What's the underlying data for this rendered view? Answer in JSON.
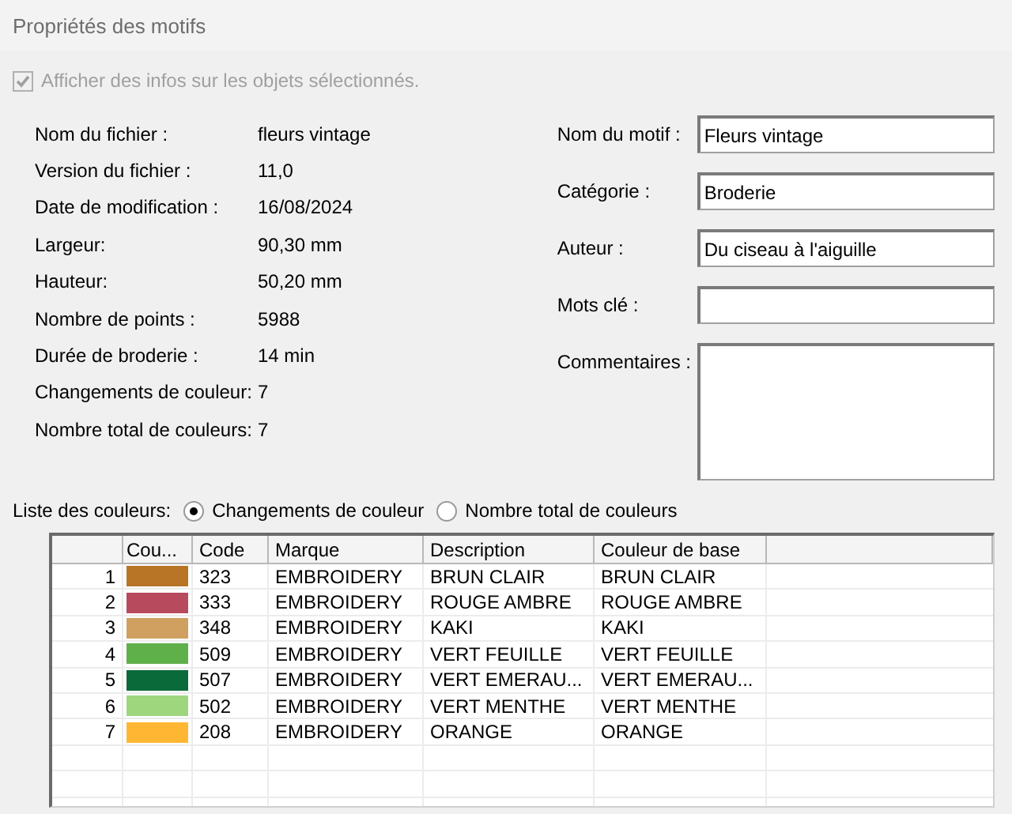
{
  "window": {
    "title": "Propriétés des motifs"
  },
  "show_info": {
    "label": "Afficher des infos sur les objets sélectionnés.",
    "checked": true,
    "disabled": true
  },
  "file_info": [
    {
      "label": "Nom du fichier :",
      "value": "fleurs vintage"
    },
    {
      "label": "Version du fichier :",
      "value": "11,0"
    },
    {
      "label": "Date de modification :",
      "value": "16/08/2024"
    },
    {
      "label": "Largeur:",
      "value": "90,30 mm"
    },
    {
      "label": "Hauteur:",
      "value": "50,20 mm"
    },
    {
      "label": "Nombre de points :",
      "value": "5988"
    },
    {
      "label": "Durée de broderie :",
      "value": "14 min"
    },
    {
      "label": "Changements de couleur:",
      "value": "7"
    },
    {
      "label": "Nombre total de couleurs:",
      "value": "7"
    }
  ],
  "fields": [
    {
      "label": "Nom du motif :",
      "value": "Fleurs vintage",
      "kind": "line"
    },
    {
      "label": "Catégorie :",
      "value": "Broderie",
      "kind": "line"
    },
    {
      "label": "Auteur :",
      "value": "Du ciseau à l'aiguille",
      "kind": "line"
    },
    {
      "label": "Mots clé :",
      "kind": "line"
    },
    {
      "label": "Commentaires :",
      "kind": "area"
    }
  ],
  "color_list": {
    "label": "Liste des couleurs:",
    "options": [
      {
        "label": "Changements de couleur",
        "selected": true
      },
      {
        "label": "Nombre total de couleurs",
        "selected": false
      }
    ]
  },
  "table": {
    "columns": [
      "Cou...",
      "Code",
      "Marque",
      "Description",
      "Couleur de base"
    ],
    "rows": [
      {
        "index": "1",
        "color": "#b87526",
        "code": "323",
        "brand": "EMBROIDERY",
        "description": "BRUN CLAIR",
        "base": "BRUN CLAIR"
      },
      {
        "index": "2",
        "color": "#b84a5e",
        "code": "333",
        "brand": "EMBROIDERY",
        "description": "ROUGE AMBRE",
        "base": "ROUGE AMBRE"
      },
      {
        "index": "3",
        "color": "#d0a060",
        "code": "348",
        "brand": "EMBROIDERY",
        "description": "KAKI",
        "base": "KAKI"
      },
      {
        "index": "4",
        "color": "#5fb04a",
        "code": "509",
        "brand": "EMBROIDERY",
        "description": "VERT FEUILLE",
        "base": "VERT FEUILLE"
      },
      {
        "index": "5",
        "color": "#0a6a3a",
        "code": "507",
        "brand": "EMBROIDERY",
        "description": "VERT EMERAU...",
        "base": "VERT EMERAU..."
      },
      {
        "index": "6",
        "color": "#9ed67e",
        "code": "502",
        "brand": "EMBROIDERY",
        "description": "VERT MENTHE",
        "base": "VERT MENTHE"
      },
      {
        "index": "7",
        "color": "#ffb733",
        "code": "208",
        "brand": "EMBROIDERY",
        "description": "ORANGE",
        "base": "ORANGE"
      }
    ]
  }
}
